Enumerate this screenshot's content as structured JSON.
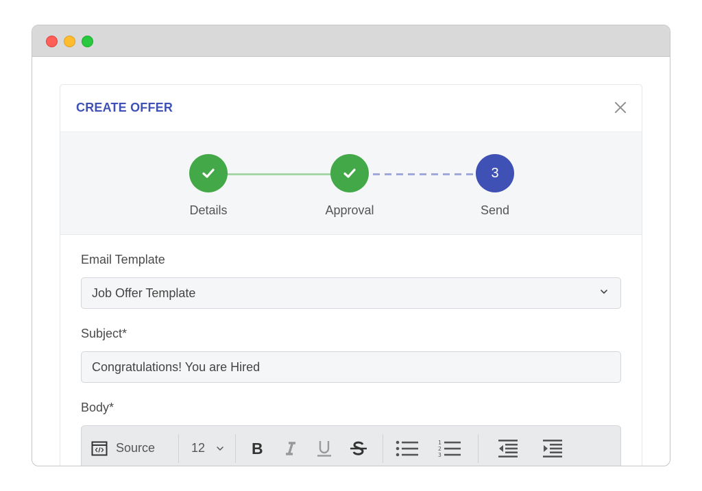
{
  "window": {
    "controls": [
      "close",
      "minimize",
      "maximize"
    ],
    "colors": {
      "close": "#fe5f57",
      "minimize": "#febc2e",
      "maximize": "#28c840"
    }
  },
  "modal": {
    "title": "CREATE OFFER",
    "close_icon": "close-icon",
    "accent_color": "#3f51b5"
  },
  "stepper": {
    "steps": [
      {
        "label": "Details",
        "state": "complete",
        "icon": "check-icon"
      },
      {
        "label": "Approval",
        "state": "complete",
        "icon": "check-icon"
      },
      {
        "label": "Send",
        "state": "active",
        "number": "3"
      }
    ],
    "complete_color": "#43a847",
    "active_color": "#3f51b5"
  },
  "form": {
    "email_template": {
      "label": "Email Template",
      "value": "Job Offer Template"
    },
    "subject": {
      "label": "Subject*",
      "value": "Congratulations! You are Hired"
    },
    "body": {
      "label": "Body*",
      "toolbar": {
        "source_label": "Source",
        "font_size": "12",
        "buttons": [
          "bold",
          "italic",
          "underline",
          "strikethrough",
          "bulleted-list",
          "numbered-list",
          "outdent",
          "indent"
        ]
      }
    }
  }
}
